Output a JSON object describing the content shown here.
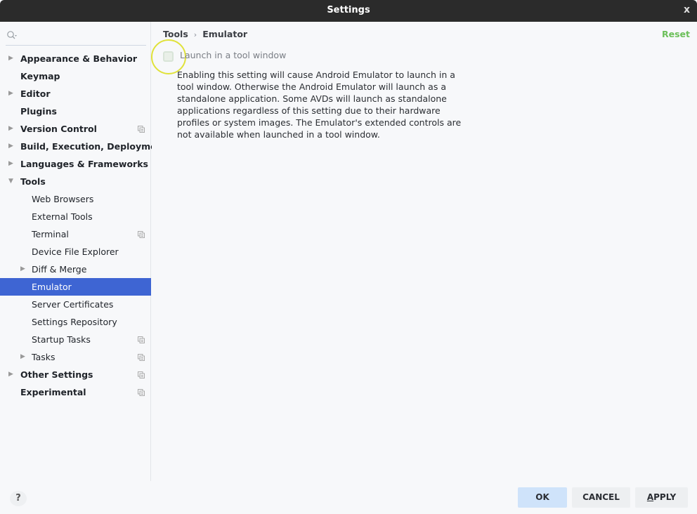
{
  "window": {
    "title": "Settings",
    "close_label": "x"
  },
  "search": {
    "placeholder": ""
  },
  "tree": [
    {
      "label": "Appearance & Behavior",
      "level": 0,
      "bold": true,
      "arrow": "right",
      "project": false
    },
    {
      "label": "Keymap",
      "level": 0,
      "bold": true,
      "arrow": "",
      "project": false
    },
    {
      "label": "Editor",
      "level": 0,
      "bold": true,
      "arrow": "right",
      "project": false
    },
    {
      "label": "Plugins",
      "level": 0,
      "bold": true,
      "arrow": "",
      "project": false
    },
    {
      "label": "Version Control",
      "level": 0,
      "bold": true,
      "arrow": "right",
      "project": true
    },
    {
      "label": "Build, Execution, Deployment",
      "level": 0,
      "bold": true,
      "arrow": "right",
      "project": false
    },
    {
      "label": "Languages & Frameworks",
      "level": 0,
      "bold": true,
      "arrow": "right",
      "project": false
    },
    {
      "label": "Tools",
      "level": 0,
      "bold": true,
      "arrow": "down",
      "project": false
    },
    {
      "label": "Web Browsers",
      "level": 1,
      "bold": false,
      "arrow": "",
      "project": false
    },
    {
      "label": "External Tools",
      "level": 1,
      "bold": false,
      "arrow": "",
      "project": false
    },
    {
      "label": "Terminal",
      "level": 1,
      "bold": false,
      "arrow": "",
      "project": true
    },
    {
      "label": "Device File Explorer",
      "level": 1,
      "bold": false,
      "arrow": "",
      "project": false
    },
    {
      "label": "Diff & Merge",
      "level": 1,
      "bold": false,
      "arrow": "right",
      "project": false
    },
    {
      "label": "Emulator",
      "level": 1,
      "bold": false,
      "arrow": "",
      "project": false,
      "selected": true
    },
    {
      "label": "Server Certificates",
      "level": 1,
      "bold": false,
      "arrow": "",
      "project": false
    },
    {
      "label": "Settings Repository",
      "level": 1,
      "bold": false,
      "arrow": "",
      "project": false
    },
    {
      "label": "Startup Tasks",
      "level": 1,
      "bold": false,
      "arrow": "",
      "project": true
    },
    {
      "label": "Tasks",
      "level": 1,
      "bold": false,
      "arrow": "right",
      "project": true
    },
    {
      "label": "Other Settings",
      "level": 0,
      "bold": true,
      "arrow": "right",
      "project": true
    },
    {
      "label": "Experimental",
      "level": 0,
      "bold": true,
      "arrow": "",
      "project": true
    }
  ],
  "breadcrumb": {
    "parent": "Tools",
    "separator": "›",
    "current": "Emulator"
  },
  "reset_label": "Reset",
  "option": {
    "label": "Launch in a tool window",
    "checked": false,
    "description": "Enabling this setting will cause Android Emulator to launch in a tool window. Otherwise the Android Emulator will launch as a standalone application. Some AVDs will launch as standalone applications regardless of this setting due to their hardware profiles or system images. The Emulator's extended controls are not available when launched in a tool window."
  },
  "footer": {
    "help_label": "?",
    "ok_label": "OK",
    "cancel_label": "CANCEL",
    "apply_label_mnemonic": "A",
    "apply_label_rest": "PPLY"
  },
  "colors": {
    "selection": "#3e65d3",
    "reset": "#6bbf59",
    "ok_button": "#cfe3fa",
    "titlebar": "#2b2b2b"
  }
}
